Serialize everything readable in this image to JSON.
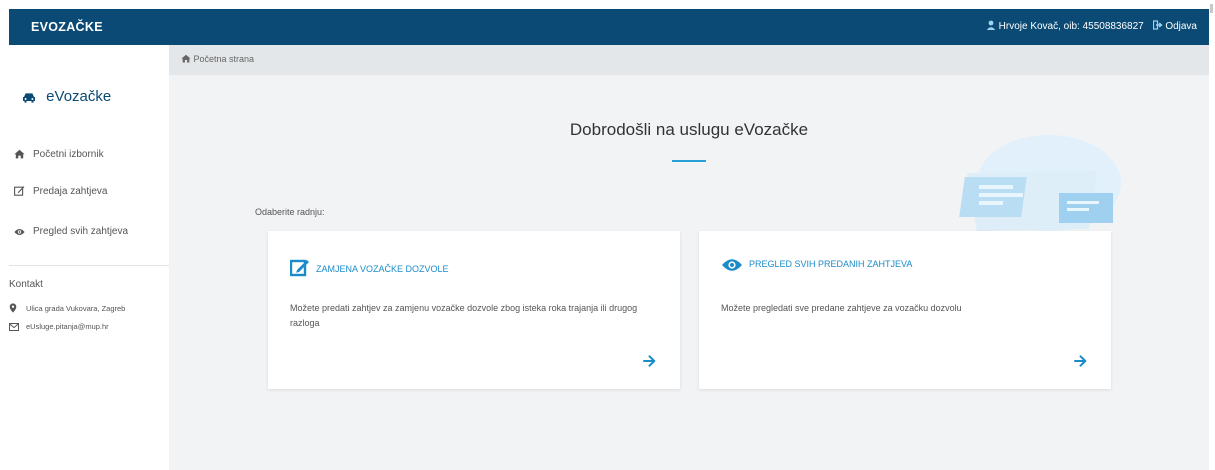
{
  "header": {
    "brand": "EVOZAČKE",
    "user_text": "Hrvoje Kovač, oib: 45508836827",
    "logout_label": "Odjava"
  },
  "sidebar": {
    "brand": "eVozačke",
    "items": [
      {
        "label": "Početni izbornik",
        "icon": "home-icon"
      },
      {
        "label": "Predaja zahtjeva",
        "icon": "edit-icon"
      },
      {
        "label": "Pregled svih zahtjeva",
        "icon": "eye-icon"
      }
    ],
    "contact": {
      "title": "Kontakt",
      "address": "Ulica grada Vukovara, Zagreb",
      "email": "eUsluge.pitanja@mup.hr"
    }
  },
  "breadcrumb": {
    "label": "Početna strana"
  },
  "main": {
    "title": "Dobrodošli na uslugu eVozačke",
    "choose_label": "Odaberite radnju:",
    "cards": [
      {
        "title": "ZAMJENA VOZAČKE DOZVOLE",
        "description": "Možete predati zahtjev za zamjenu vozačke dozvole zbog isteka roka trajanja ili drugog razloga",
        "icon": "edit-icon"
      },
      {
        "title": "PREGLED SVIH PREDANIH ZAHTJEVA",
        "description": "Možete pregledati sve predane zahtjeve za vozačku dozvolu",
        "icon": "eye-icon"
      }
    ]
  },
  "colors": {
    "header_bg": "#0b4a74",
    "accent": "#1b8cc9",
    "page_bg": "#f2f3f5",
    "breadcrumb_bg": "#e4e7ea"
  }
}
